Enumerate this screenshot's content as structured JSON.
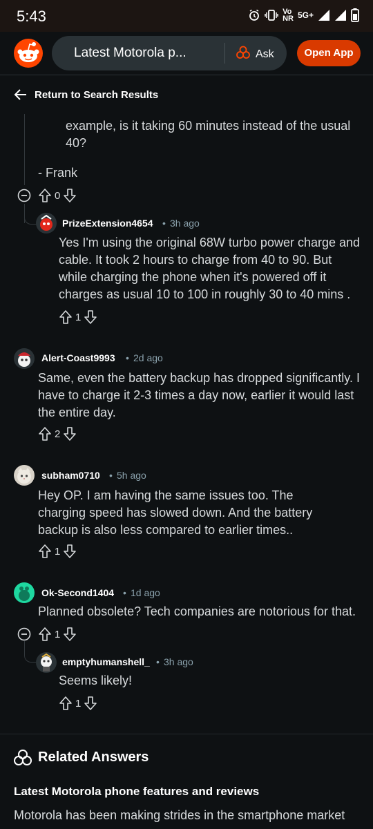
{
  "status_bar": {
    "time": "5:43",
    "volte_label": "Vo",
    "nr_label": "NR",
    "network_label": "5G+"
  },
  "header": {
    "search_text": "Latest Motorola p...",
    "ask_label": "Ask",
    "open_app_label": "Open App"
  },
  "back_label": "Return to Search Results",
  "comments": {
    "frank_text": "example, is it taking 60 minutes instead of the usual 40?",
    "frank_sign": "- Frank",
    "frank_votes": "0",
    "prize": {
      "author": "PrizeExtension4654",
      "time": "3h ago",
      "text": "Yes I'm using the original 68W turbo power charge and cable. It took 2 hours to charge from 40 to 90. But while charging the phone when it's powered off it charges as usual 10 to 100 in roughly 30 to 40 mins .",
      "votes": "1"
    },
    "alert": {
      "author": "Alert-Coast9993",
      "time": "2d ago",
      "text": "Same, even the battery backup has dropped significantly. I have to charge it 2-3 times a day now, earlier it would last the entire day.",
      "votes": "2"
    },
    "subham": {
      "author": "subham0710",
      "time": "5h ago",
      "text": "Hey OP. I am having the same issues too. The charging speed has slowed down. And the battery backup is also less compared to earlier times..",
      "votes": "1"
    },
    "ok": {
      "author": "Ok-Second1404",
      "time": "1d ago",
      "text": "Planned obsolete? Tech companies are notorious for that.",
      "votes": "1"
    },
    "empty": {
      "author": "emptyhumanshell_",
      "time": "3h ago",
      "text": "Seems likely!",
      "votes": "1"
    },
    "separator": "•"
  },
  "related": {
    "title": "Related Answers",
    "question": "Latest Motorola phone features and reviews",
    "answer": "Motorola has been making strides in the smartphone market"
  },
  "colors": {
    "background": "#0e1113",
    "accent": "#d93a00",
    "reddit_orange": "#ff4500"
  }
}
